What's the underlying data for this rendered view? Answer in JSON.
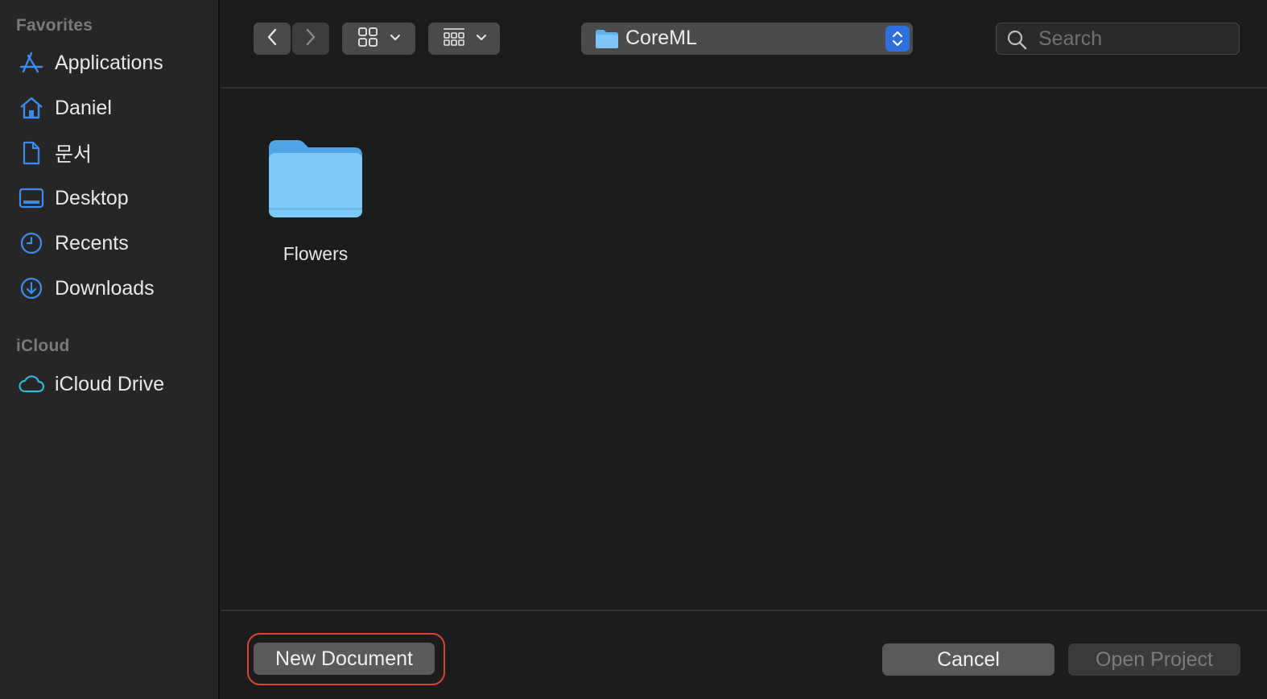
{
  "sidebar": {
    "favorites_header": "Favorites",
    "icloud_header": "iCloud",
    "items": [
      {
        "label": "Applications",
        "icon": "applications-icon"
      },
      {
        "label": "Daniel",
        "icon": "home-icon"
      },
      {
        "label": "문서",
        "icon": "document-icon"
      },
      {
        "label": "Desktop",
        "icon": "desktop-icon"
      },
      {
        "label": "Recents",
        "icon": "clock-icon"
      },
      {
        "label": "Downloads",
        "icon": "download-icon"
      },
      {
        "label": "iCloud Drive",
        "icon": "cloud-icon"
      }
    ]
  },
  "toolbar": {
    "path_label": "CoreML",
    "search_placeholder": "Search"
  },
  "files": [
    {
      "name": "Flowers",
      "icon": "folder-icon"
    }
  ],
  "footer": {
    "new_document": "New Document",
    "cancel": "Cancel",
    "open_project": "Open Project"
  },
  "colors": {
    "accent": "#2f81f7",
    "folder": "#6bbcf4",
    "highlight_ring": "#e0442f"
  }
}
